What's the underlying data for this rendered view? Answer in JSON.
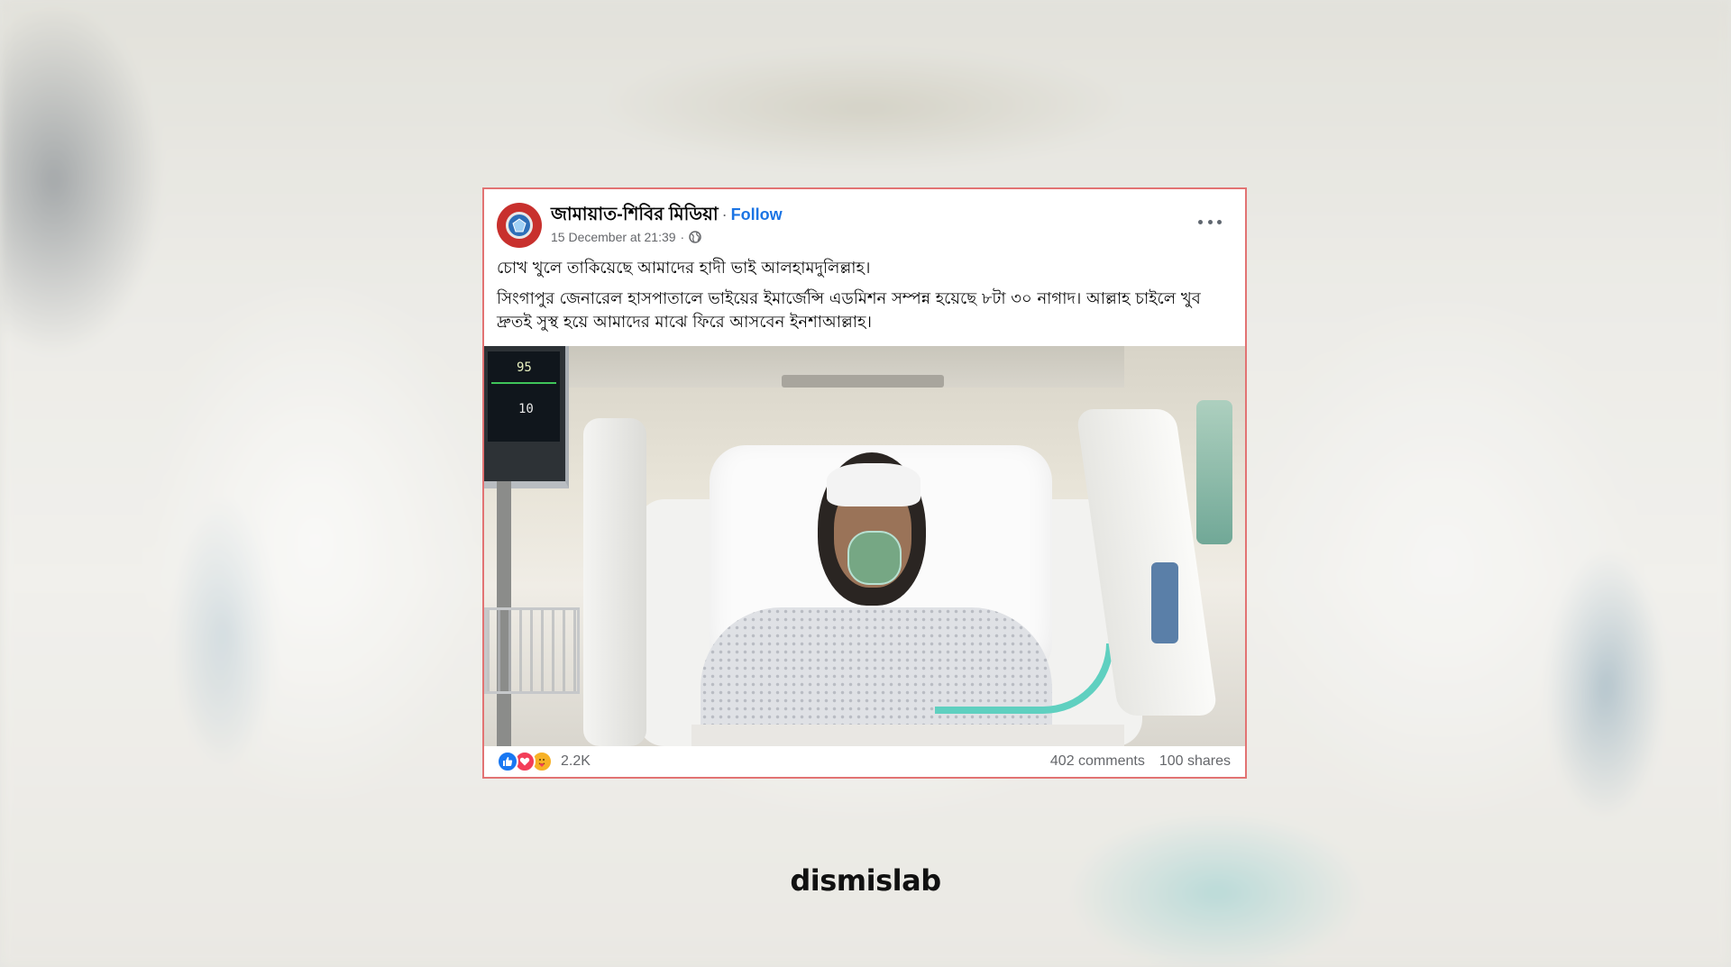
{
  "post": {
    "page_name": "জামায়াত-শিবির মিডিয়া",
    "separator": "·",
    "follow_label": "Follow",
    "timestamp": "15 December at 21:39",
    "meta_separator": "·",
    "paragraphs": [
      "চোখ খুলে তাকিয়েছে আমাদের হাদী ভাই আলহামদুলিল্লাহ।",
      "সিংগাপুর জেনারেল হাসপাতালে ভাইয়ের ইমার্জেন্সি এডমিশন  সম্পন্ন হয়েছে ৮টা ৩০ নাগাদ। আল্লাহ চাইলে খুব দ্রুতই সুস্থ হয়ে আমাদের মাঝে ফিরে আসবেন ইনশাআল্লাহ।"
    ],
    "photo_monitor_values": [
      "95",
      "10"
    ],
    "reactions": [
      "like",
      "love",
      "care"
    ],
    "reaction_count": "2.2K",
    "comments": "402 comments",
    "shares": "100 shares"
  },
  "watermark": "dismislab",
  "colors": {
    "card_border": "#e27373",
    "follow": "#1b74e4",
    "like": "#1877f2",
    "love": "#f33e58",
    "care": "#f7b125"
  }
}
